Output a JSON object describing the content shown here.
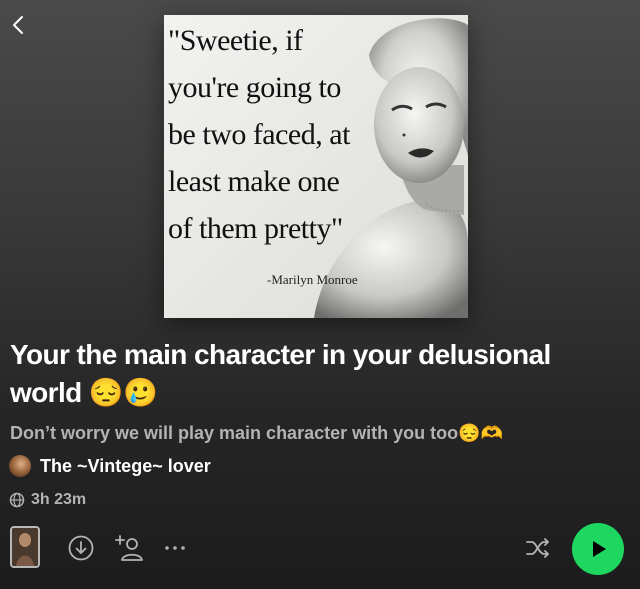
{
  "nav": {
    "back_icon": "chevron-left-icon"
  },
  "cover": {
    "quote": "\"Sweetie, if\nyou're going to\nbe two faced, at\nleast make one\nof them pretty\"",
    "attribution": "-Marilyn Monroe"
  },
  "playlist": {
    "title": "Your the main character in your delusional world 😔🥲",
    "description": "Don’t worry we will play main character with you too😔🫶",
    "owner": "The ~Vintege~ lover",
    "duration": "3h 23m"
  },
  "actions": {
    "download_icon": "download-icon",
    "add_user_icon": "add-user-icon",
    "more_icon": "more-options-icon",
    "shuffle_icon": "shuffle-icon",
    "play_icon": "play-icon"
  },
  "colors": {
    "accent": "#1ed760",
    "secondary_text": "#b3b3b3",
    "primary_text": "#ffffff"
  }
}
